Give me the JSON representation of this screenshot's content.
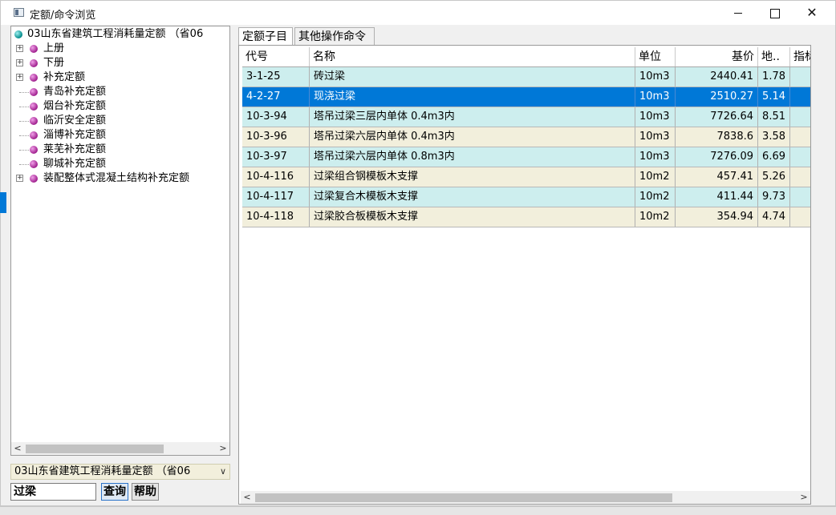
{
  "window": {
    "title": "定额/命令浏览",
    "minimize_label": "—",
    "close_label": "✕"
  },
  "tree": {
    "root": "03山东省建筑工程消耗量定额 （省06",
    "items": [
      {
        "label": "上册",
        "expandable": true
      },
      {
        "label": "下册",
        "expandable": true
      },
      {
        "label": "补充定额",
        "expandable": true
      },
      {
        "label": "青岛补充定额",
        "expandable": false
      },
      {
        "label": "烟台补充定额",
        "expandable": false
      },
      {
        "label": "临沂安全定额",
        "expandable": false
      },
      {
        "label": "淄博补充定额",
        "expandable": false
      },
      {
        "label": "莱芜补充定额",
        "expandable": false
      },
      {
        "label": "聊城补充定额",
        "expandable": false
      },
      {
        "label": "装配整体式混凝土结构补充定额",
        "expandable": true
      }
    ],
    "expander_symbol": "+"
  },
  "combo": {
    "value": "03山东省建筑工程消耗量定额 （省06",
    "arrow": "∨"
  },
  "search": {
    "value": "过梁",
    "query_label": "查询",
    "help_label": "帮助"
  },
  "tabs": [
    {
      "label": "定额子目",
      "active": true
    },
    {
      "label": "其他操作命令",
      "active": false
    }
  ],
  "grid": {
    "columns": [
      "代号",
      "名称",
      "单位",
      "基价",
      "地..",
      "指标"
    ],
    "rows": [
      {
        "code": "3-1-25",
        "name": "砖过梁",
        "unit": "10m3",
        "price": "2440.41",
        "local": "1.78",
        "selected": false,
        "bg": "#cdeeee"
      },
      {
        "code": "4-2-27",
        "name": "现浇过梁",
        "unit": "10m3",
        "price": "2510.27",
        "local": "5.14",
        "selected": true,
        "bg": "#0078d7"
      },
      {
        "code": "10-3-94",
        "name": "塔吊过梁三层内单体 0.4m3内",
        "unit": "10m3",
        "price": "7726.64",
        "local": "8.51",
        "selected": false,
        "bg": "#cdeeee"
      },
      {
        "code": "10-3-96",
        "name": "塔吊过梁六层内单体 0.4m3内",
        "unit": "10m3",
        "price": "7838.6",
        "local": "3.58",
        "selected": false,
        "bg": "#f2efdc"
      },
      {
        "code": "10-3-97",
        "name": "塔吊过梁六层内单体 0.8m3内",
        "unit": "10m3",
        "price": "7276.09",
        "local": "6.69",
        "selected": false,
        "bg": "#cdeeee"
      },
      {
        "code": "10-4-116",
        "name": "过梁组合钢模板木支撑",
        "unit": "10m2",
        "price": "457.41",
        "local": "5.26",
        "selected": false,
        "bg": "#f2efdc"
      },
      {
        "code": "10-4-117",
        "name": "过梁复合木模板木支撑",
        "unit": "10m2",
        "price": "411.44",
        "local": "9.73",
        "selected": false,
        "bg": "#cdeeee"
      },
      {
        "code": "10-4-118",
        "name": "过梁胶合板模板木支撑",
        "unit": "10m2",
        "price": "354.94",
        "local": "4.74",
        "selected": false,
        "bg": "#f2efdc"
      }
    ]
  }
}
